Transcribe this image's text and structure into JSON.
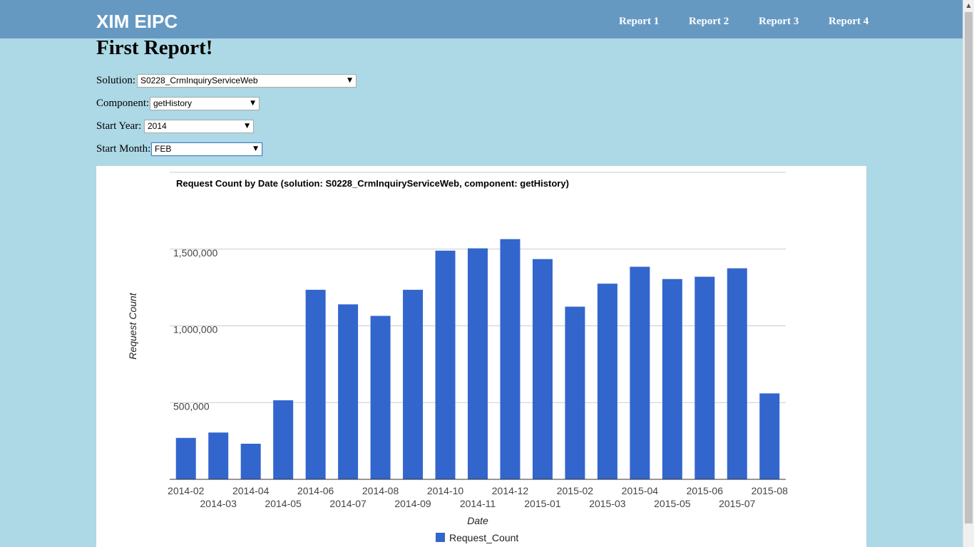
{
  "navbar": {
    "brand": "XIM EIPC",
    "links": [
      "Report 1",
      "Report 2",
      "Report 3",
      "Report 4"
    ]
  },
  "page": {
    "title": "First Report!"
  },
  "form": {
    "solution": {
      "label": "Solution:",
      "value": "S0228_CrmInquiryServiceWeb"
    },
    "component": {
      "label": "Component:",
      "value": "getHistory"
    },
    "start_year": {
      "label": "Start Year:",
      "value": "2014"
    },
    "start_month": {
      "label": "Start Month:",
      "value": "FEB"
    }
  },
  "colors": {
    "header_bg": "#6699c2",
    "page_bg": "#add8e6",
    "bar": "#3366cc"
  },
  "chart_data": {
    "type": "bar",
    "title": "Request Count by Date (solution: S0228_CrmInquiryServiceWeb, component: getHistory)",
    "xlabel": "Date",
    "ylabel": "Request Count",
    "ylim": [
      0,
      2000000
    ],
    "yticks": [
      500000,
      1000000,
      1500000
    ],
    "ytick_labels": [
      "500,000",
      "1,000,000",
      "1,500,000"
    ],
    "grid": true,
    "legend_position": "bottom",
    "categories": [
      "2014-02",
      "2014-03",
      "2014-04",
      "2014-05",
      "2014-06",
      "2014-07",
      "2014-08",
      "2014-09",
      "2014-10",
      "2014-11",
      "2014-12",
      "2015-01",
      "2015-02",
      "2015-03",
      "2015-04",
      "2015-05",
      "2015-06",
      "2015-07",
      "2015-08"
    ],
    "series": [
      {
        "name": "Request_Count",
        "color": "#3366cc",
        "values": [
          270000,
          305000,
          232000,
          515000,
          1235000,
          1140000,
          1065000,
          1235000,
          1490000,
          1505000,
          1565000,
          1435000,
          1125000,
          1275000,
          1385000,
          1305000,
          1320000,
          1375000,
          560000
        ]
      }
    ]
  }
}
